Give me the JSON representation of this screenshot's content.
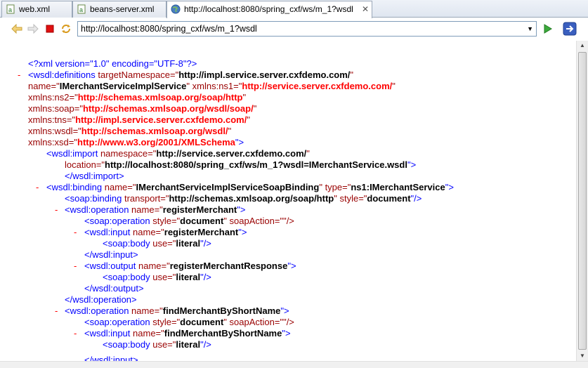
{
  "tabs": [
    {
      "label": "web.xml",
      "icon": "xml-file-icon"
    },
    {
      "label": "beans-server.xml",
      "icon": "xml-file-icon"
    },
    {
      "label": "http://localhost:8080/spring_cxf/ws/m_1?wsdl",
      "icon": "globe-icon",
      "close": "✕"
    }
  ],
  "address": {
    "url": "http://localhost:8080/spring_cxf/ws/m_1?wsdl",
    "dropdown": "▼"
  },
  "toolbar": {
    "back": "back-arrow-icon",
    "forward": "forward-arrow-icon",
    "stop": "stop-icon",
    "refresh": "refresh-icon",
    "go": "go-play-icon",
    "open_external": "open-external-icon"
  },
  "xml": {
    "decl": "<?xml version=\"1.0\" encoding=\"UTF-8\"?>",
    "definitions_open": "<wsdl:definitions",
    "targetNamespace_attr": "targetNamespace=\"",
    "targetNamespace_val": "http://impl.service.server.cxfdemo.com/",
    "quote": "\"",
    "name_attr": "name=\"",
    "name_val": "IMerchantServiceImplService",
    "ns1_attr": "xmlns:ns1=\"",
    "ns1_val": "http://service.server.cxfdemo.com/",
    "ns2_attr": "xmlns:ns2=\"",
    "ns2_val": "http://schemas.xmlsoap.org/soap/http",
    "soap_attr": "xmlns:soap=\"",
    "soap_val": "http://schemas.xmlsoap.org/wsdl/soap/",
    "tns_attr": "xmlns:tns=\"",
    "tns_val": "http://impl.service.server.cxfdemo.com/",
    "wsdl_attr": "xmlns:wsdl=\"",
    "wsdl_val": "http://schemas.xmlsoap.org/wsdl/",
    "xsd_attr": "xmlns:xsd=\"",
    "xsd_val": "http://www.w3.org/2001/XMLSchema",
    "close_bracket": "\">",
    "import_open": "<wsdl:import",
    "import_ns_attr": "namespace=\"",
    "import_ns_val": "http://service.server.cxfdemo.com/",
    "import_loc_attr": "location=\"",
    "import_loc_val": "http://localhost:8080/spring_cxf/ws/m_1?wsdl=IMerchantService.wsdl",
    "import_close": "</wsdl:import>",
    "binding_open": "<wsdl:binding",
    "binding_name_val": "IMerchantServiceImplServiceSoapBinding",
    "binding_type_attr": "type=\"",
    "binding_type_val": "ns1:IMerchantService",
    "soap_binding_open": "<soap:binding",
    "transport_attr": "transport=\"",
    "transport_val": "http://schemas.xmlsoap.org/soap/http",
    "style_attr": "style=\"",
    "style_val": "document",
    "self_close": "\"/>",
    "op_open": "<wsdl:operation",
    "op1_name": "registerMerchant",
    "soap_op_open": "<soap:operation",
    "soapAction_attr": "soapAction=\"\"/>",
    "input_open": "<wsdl:input",
    "soap_body_open": "<soap:body",
    "use_attr": "use=\"",
    "use_val": "literal",
    "input_close": "</wsdl:input>",
    "output_open": "<wsdl:output",
    "output1_name": "registerMerchantResponse",
    "output_close": "</wsdl:output>",
    "op_close": "</wsdl:operation>",
    "op2_name": "findMerchantByShortName",
    "input2_close_partial": "</wsdl:input>"
  },
  "minus": "-",
  "colors": {
    "tag": "#0000ff",
    "attr": "#990000",
    "value": "#000000",
    "ns_value": "#ff0000",
    "minus": "#ff0000"
  }
}
